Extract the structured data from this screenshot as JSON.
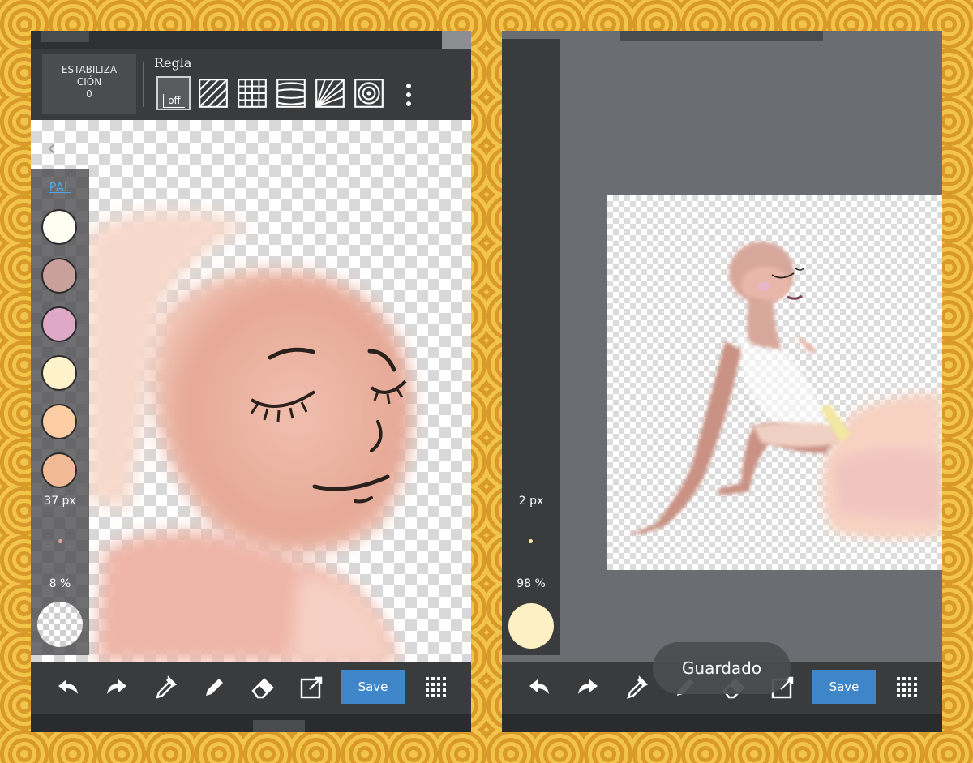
{
  "left": {
    "stabilization": {
      "line1": "ESTABILIZA",
      "line2": "CIÓN",
      "value": "0"
    },
    "ruler": {
      "label": "Regla",
      "off_label": "off"
    },
    "palette_label": "PAL",
    "palette_colors": [
      "#fdfdf2",
      "#c9a19a",
      "#dea8c6",
      "#fdf2c9",
      "#fdcda4",
      "#f2b996"
    ],
    "brush_size": "37 px",
    "opacity": "8 %",
    "current_color": "transparent",
    "save_label": "Save"
  },
  "right": {
    "brush_size": "2 px",
    "opacity": "98 %",
    "current_color": "#fdf0c4",
    "toast": "Guardado",
    "save_label": "Save"
  },
  "icons": [
    "undo-icon",
    "redo-icon",
    "eyedropper-icon",
    "pen-icon",
    "eraser-icon",
    "export-icon",
    "grid-menu-icon"
  ]
}
